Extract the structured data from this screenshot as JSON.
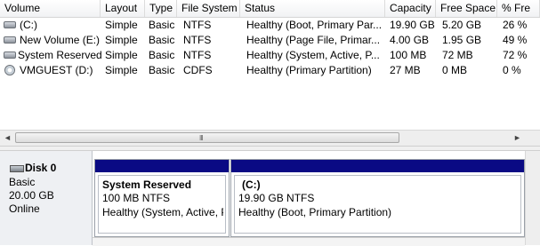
{
  "columns": [
    "Volume",
    "Layout",
    "Type",
    "File System",
    "Status",
    "Capacity",
    "Free Space",
    "% Fre"
  ],
  "volumes": [
    {
      "icon": "disk-icon",
      "name": "(C:)",
      "layout": "Simple",
      "type": "Basic",
      "fs": "NTFS",
      "status": "Healthy (Boot, Primary Par...",
      "capacity": "19.90 GB",
      "free": "5.20 GB",
      "pct": "26 %"
    },
    {
      "icon": "disk-icon",
      "name": "New Volume (E:)",
      "layout": "Simple",
      "type": "Basic",
      "fs": "NTFS",
      "status": "Healthy (Page File, Primar...",
      "capacity": "4.00 GB",
      "free": "1.95 GB",
      "pct": "49 %"
    },
    {
      "icon": "disk-icon",
      "name": "System Reserved",
      "layout": "Simple",
      "type": "Basic",
      "fs": "NTFS",
      "status": "Healthy (System, Active, P...",
      "capacity": "100 MB",
      "free": "72 MB",
      "pct": "72 %"
    },
    {
      "icon": "cd-icon",
      "name": "VMGUEST (D:)",
      "layout": "Simple",
      "type": "Basic",
      "fs": "CDFS",
      "status": "Healthy (Primary Partition)",
      "capacity": "27 MB",
      "free": "0 MB",
      "pct": "0 %"
    }
  ],
  "scroll": {
    "left": "◄",
    "right": "►",
    "grip": "III"
  },
  "disk": {
    "name": "Disk 0",
    "kind": "Basic",
    "size": "20.00 GB",
    "state": "Online"
  },
  "partitions": [
    {
      "title": "System Reserved",
      "size": "100 MB NTFS",
      "status": "Healthy (System, Active, P"
    },
    {
      "title": "(C:)",
      "size": "19.90 GB NTFS",
      "status": "Healthy (Boot, Primary Partition)"
    }
  ],
  "colors": {
    "partition_bar": "#0a0a84"
  }
}
